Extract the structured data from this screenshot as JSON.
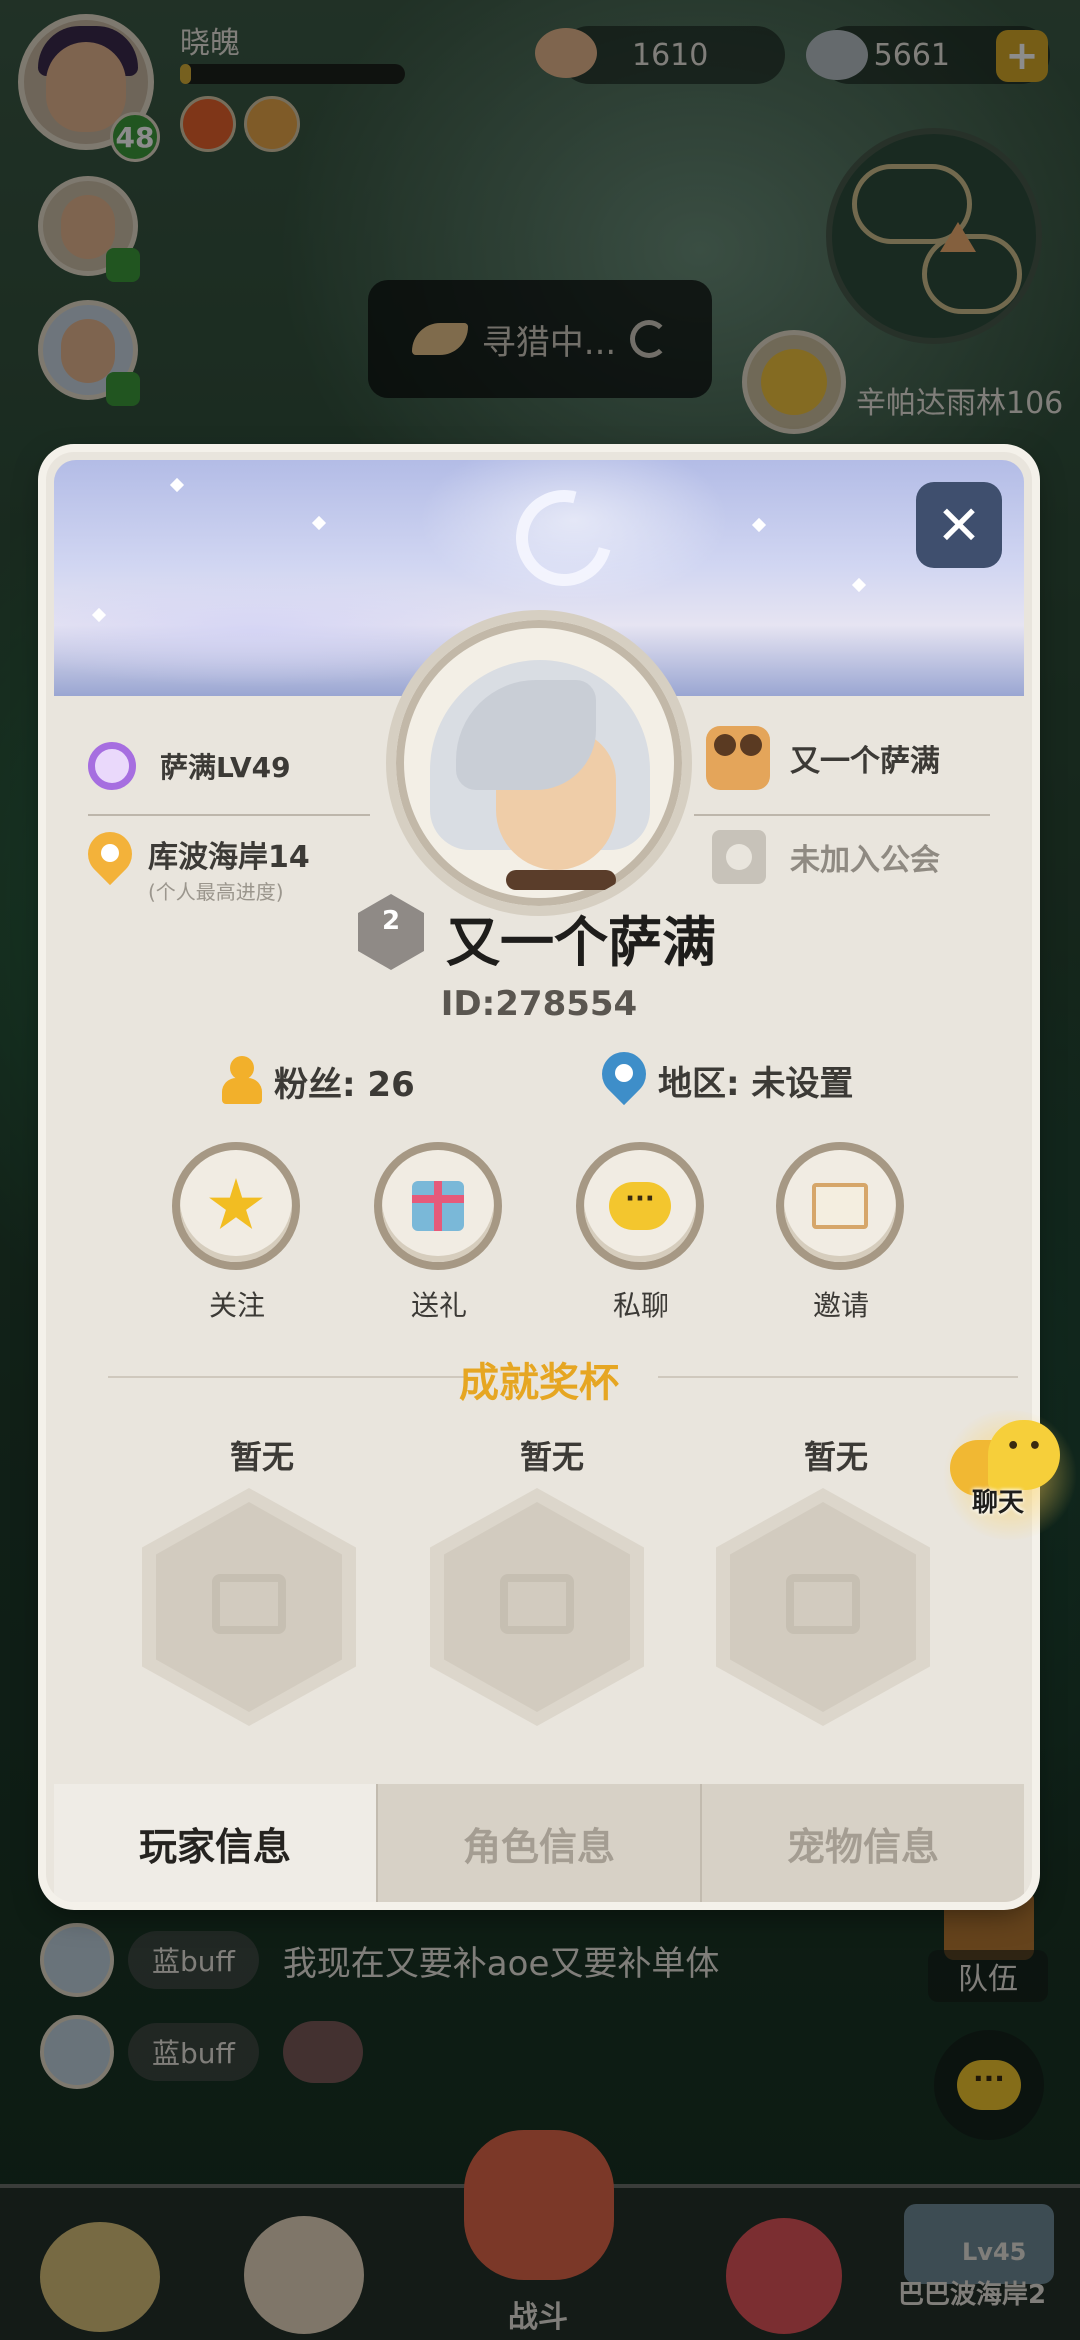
{
  "hud": {
    "player_name": "晓魄",
    "level": "48",
    "xp_progress": 0.05,
    "shells": "1610",
    "gems": "5661",
    "hunting_status": "寻猎中...",
    "location": "辛帕达雨林106"
  },
  "profile": {
    "class_level": "萨满LV49",
    "progress_stage": "库波海岸14",
    "progress_note": "(个人最高进度)",
    "partner_name": "又一个萨满",
    "guild_status": "未加入公会",
    "rank": "2",
    "name": "又一个萨满",
    "id": "ID:278554",
    "fans": "粉丝: 26",
    "region": "地区: 未设置",
    "actions": {
      "follow": "关注",
      "gift": "送礼",
      "private_chat": "私聊",
      "invite": "邀请"
    },
    "achievements_title": "成就奖杯",
    "achievement_slots": [
      "暂无",
      "暂无",
      "暂无"
    ],
    "tabs": [
      "玩家信息",
      "角色信息",
      "宠物信息"
    ]
  },
  "side": {
    "chat_label": "聊天",
    "team_label": "队伍"
  },
  "chat": [
    {
      "tag": "蓝buff",
      "text": "我现在又要补aoe又要补单体"
    },
    {
      "tag": "蓝buff",
      "text": ""
    }
  ],
  "bottom_nav": {
    "battle_label": "战斗",
    "locked_level": "Lv45",
    "locked_stage": "巴巴波海岸2"
  },
  "colors": {
    "accent_gold": "#e6a622",
    "level_green": "#3d9b3b",
    "panel_bg": "#e9e5dd"
  },
  "icons": [
    "class-icon",
    "pin-icon",
    "couple-icon",
    "guild-icon",
    "rank-badge-icon",
    "fan-icon",
    "star-icon",
    "gift-icon",
    "chat-bubble-icon",
    "mail-icon",
    "close-icon"
  ]
}
